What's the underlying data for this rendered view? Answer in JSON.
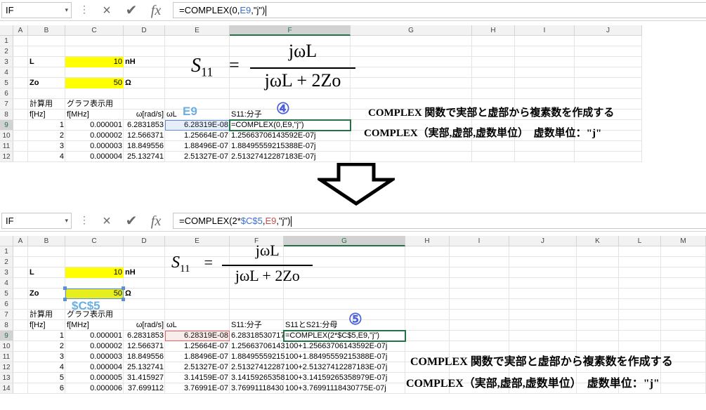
{
  "top": {
    "namebox": "IF",
    "formula_parts": [
      {
        "text": "=COMPLEX(0,",
        "color": ""
      },
      {
        "text": "E9",
        "color": "blue"
      },
      {
        "text": ",\"j\")",
        "color": ""
      }
    ],
    "columns": [
      "A",
      "B",
      "C",
      "D",
      "E",
      "F",
      "G",
      "H",
      "I",
      "J"
    ],
    "rows": [
      "1",
      "2",
      "3",
      "4",
      "5",
      "6",
      "7",
      "8",
      "9",
      "10",
      "11",
      "12"
    ],
    "cells": {
      "L_label": "L",
      "L_value": "10",
      "L_unit": "nH",
      "Zo_label": "Zo",
      "Zo_value": "50",
      "Zo_unit": "Ω",
      "h_calc": "計算用",
      "h_graph": "グラフ表示用",
      "h_fhz": "f[Hz]",
      "h_fmhz": "f[MHz]",
      "h_omega": "ω[rad/s]",
      "h_omegaL": "ωL",
      "h_s11": "S11:分子",
      "callout": "E9",
      "data": [
        [
          "1",
          "0.000001",
          "6.2831853",
          "6.28319E-08",
          "=COMPLEX(0,E9,\"j\")"
        ],
        [
          "2",
          "0.000002",
          "12.566371",
          "1.25664E-07",
          "1.25663706143592E-07j"
        ],
        [
          "3",
          "0.000003",
          "18.849556",
          "1.88496E-07",
          "1.88495559215388E-07j"
        ],
        [
          "4",
          "0.000004",
          "25.132741",
          "2.51327E-07",
          "2.51327412287183E-07j"
        ]
      ]
    },
    "step": "④",
    "annot1": "COMPLEX 関数で実部と虚部から複素数を作成する",
    "annot2": "COMPLEX（実部,虚部,虚数単位）　虚数単位：\"j\""
  },
  "formula_image": {
    "lhs": "S",
    "lhs_sub": "11",
    "eq": "=",
    "num": "jωL",
    "den": "jωL + 2Zo"
  },
  "bottom": {
    "namebox": "IF",
    "formula_parts": [
      {
        "text": "=COMPLEX(2*",
        "color": ""
      },
      {
        "text": "$C$5",
        "color": "blue"
      },
      {
        "text": ",",
        "color": ""
      },
      {
        "text": "E9",
        "color": "red"
      },
      {
        "text": ",\"j\")",
        "color": ""
      }
    ],
    "columns": [
      "A",
      "B",
      "C",
      "D",
      "E",
      "F",
      "G",
      "H",
      "I",
      "J",
      "K",
      "L",
      "M"
    ],
    "rows": [
      "1",
      "2",
      "3",
      "4",
      "5",
      "6",
      "7",
      "8",
      "9",
      "10",
      "11",
      "12",
      "13",
      "14"
    ],
    "cells": {
      "L_label": "L",
      "L_value": "10",
      "L_unit": "nH",
      "Zo_label": "Zo",
      "Zo_value": "50",
      "Zo_unit": "Ω",
      "h_calc": "計算用",
      "h_graph": "グラフ表示用",
      "h_fhz": "f[Hz]",
      "h_fmhz": "f[MHz]",
      "h_omega": "ω[rad/s]",
      "h_omegaL": "ωL",
      "h_s11": "S11:分子",
      "h_s21": "S11とS21:分母",
      "callout": "$C$5",
      "data": [
        [
          "1",
          "0.000001",
          "6.2831853",
          "6.28319E-08",
          "6.28318530717",
          "=COMPLEX(2*$C$5,E9,\"j\")"
        ],
        [
          "2",
          "0.000002",
          "12.566371",
          "1.25664E-07",
          "1.25663706143",
          "100+1.25663706143592E-07j"
        ],
        [
          "3",
          "0.000003",
          "18.849556",
          "1.88496E-07",
          "1.88495559215",
          "100+1.88495559215388E-07j"
        ],
        [
          "4",
          "0.000004",
          "25.132741",
          "2.51327E-07",
          "2.51327412287",
          "100+2.51327412287183E-07j"
        ],
        [
          "5",
          "0.000005",
          "31.415927",
          "3.14159E-07",
          "3.14159265358",
          "100+3.14159265358979E-07j"
        ],
        [
          "6",
          "0.000006",
          "37.699112",
          "3.76991E-07",
          "3.76991118430",
          "100+3.76991118430775E-07j"
        ]
      ]
    },
    "step": "⑤",
    "annot1": "COMPLEX 関数で実部と虚部から複素数を作成する",
    "annot2": "COMPLEX（実部,虚部,虚数単位）　虚数単位：\"j\""
  },
  "icons": {
    "cancel": "×",
    "confirm": "✔",
    "fx": "fx",
    "dots": "⋮",
    "dropdown": "▾"
  },
  "colors": {
    "selection": "#217346",
    "yellow": "#ffff00",
    "ref_blue": "#5b8fd6",
    "ref_red": "#e06666",
    "step_circle": "#4a5fd9"
  }
}
